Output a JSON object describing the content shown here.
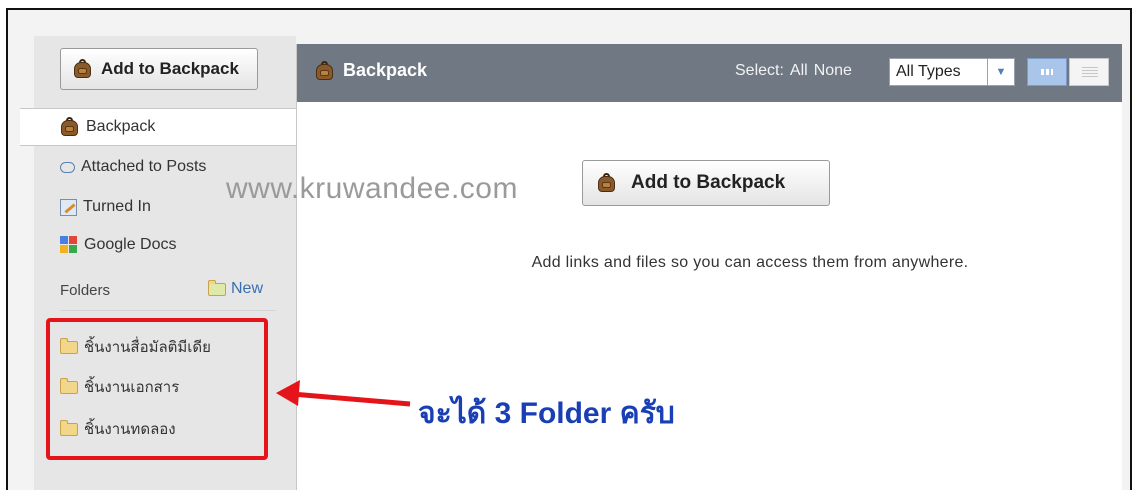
{
  "sidebar": {
    "add_button_label": "Add to Backpack",
    "items": [
      {
        "label": "Backpack",
        "icon": "backpack-icon"
      },
      {
        "label": "Attached to Posts",
        "icon": "chat-bubble-icon"
      },
      {
        "label": "Turned In",
        "icon": "turned-in-icon"
      },
      {
        "label": "Google Docs",
        "icon": "google-docs-icon"
      }
    ],
    "folders_heading": "Folders",
    "new_folder_label": "New",
    "folders": [
      {
        "label": "ชิ้นงานสื่อมัลติมีเดีย"
      },
      {
        "label": "ชิ้นงานเอกสาร"
      },
      {
        "label": "ชิ้นงานทดลอง"
      }
    ]
  },
  "main": {
    "title": "Backpack",
    "select_label": "Select:",
    "select_all": "All",
    "select_none": "None",
    "type_filter": "All Types",
    "add_button_label": "Add to Backpack",
    "empty_message": "Add links and files so you can access them from anywhere."
  },
  "overlay": {
    "watermark": "www.kruwandee.com",
    "annotation": "จะได้ 3 Folder ครับ",
    "highlight_color": "#e5141b",
    "annotation_color": "#1a3fb5"
  }
}
